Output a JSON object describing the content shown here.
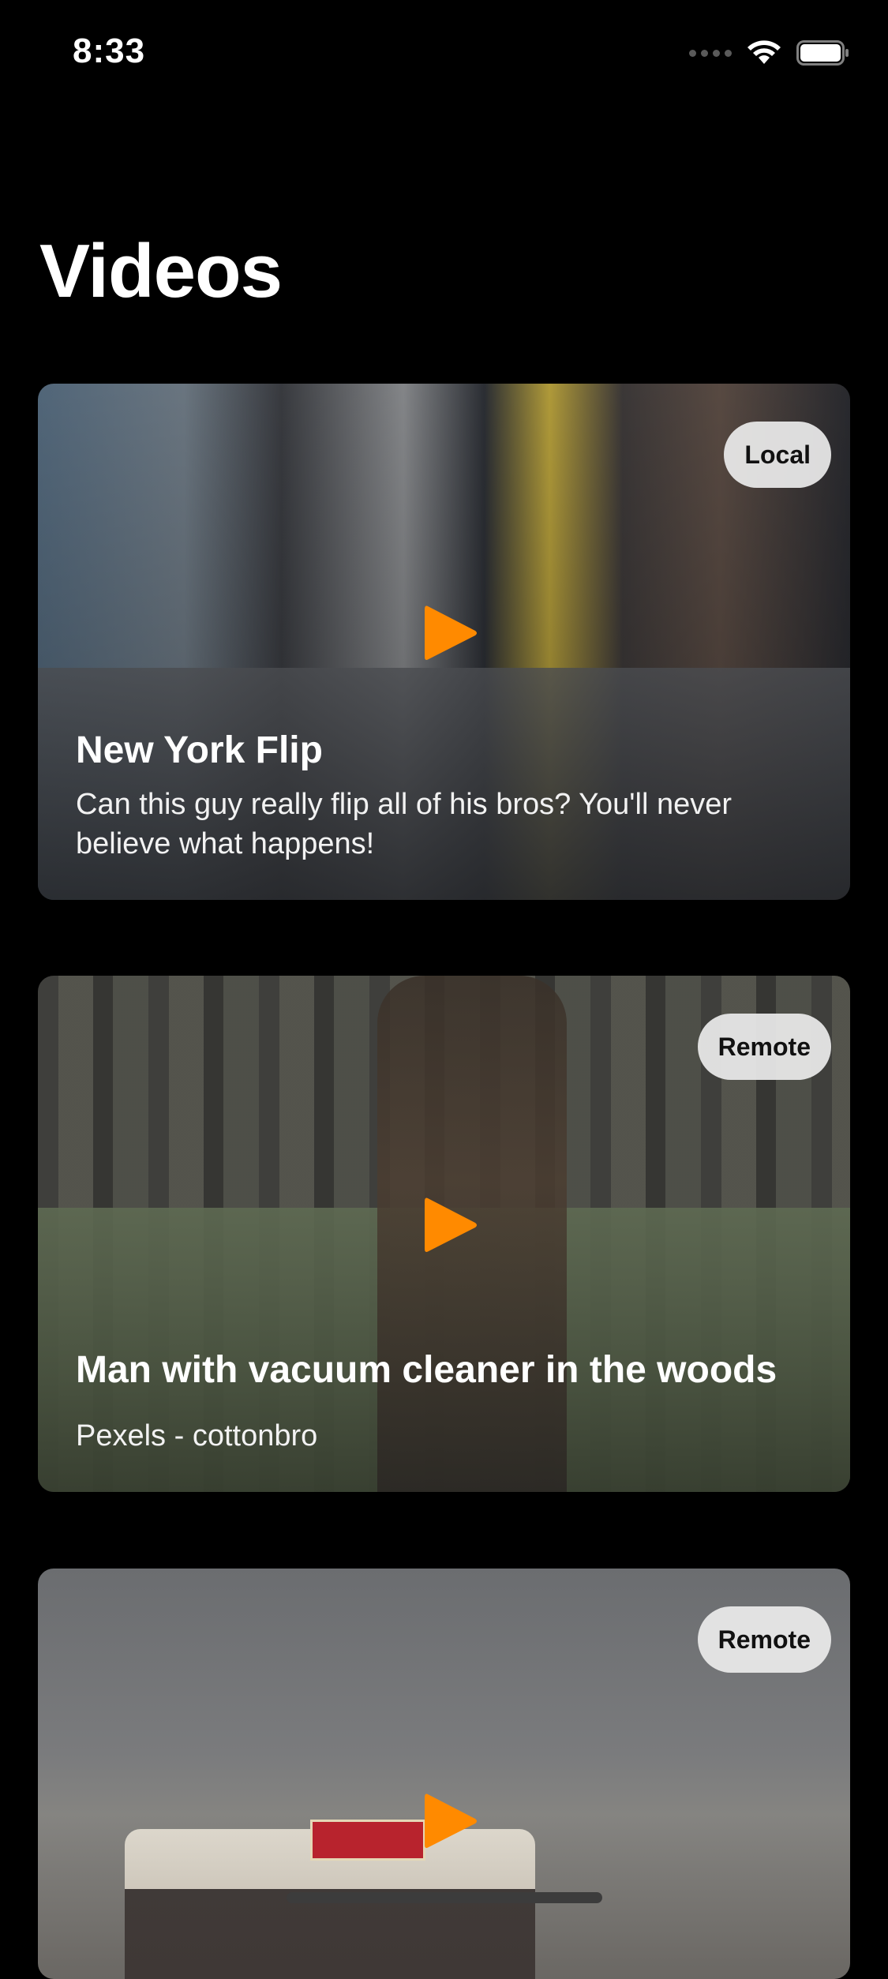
{
  "status_bar": {
    "time": "8:33",
    "icons": [
      "cellular-signal-icon",
      "wifi-icon",
      "battery-icon"
    ]
  },
  "header": {
    "title": "Videos"
  },
  "accent_color": "#ff8a00",
  "videos": [
    {
      "title": "New York Flip",
      "subtitle": "Can this guy really flip all of his bros? You'll never believe what happens!",
      "badge": "Local"
    },
    {
      "title": "Man with vacuum cleaner in the woods",
      "subtitle": "Pexels - cottonbro",
      "badge": "Remote"
    },
    {
      "title": "",
      "subtitle": "",
      "badge": "Remote"
    }
  ]
}
